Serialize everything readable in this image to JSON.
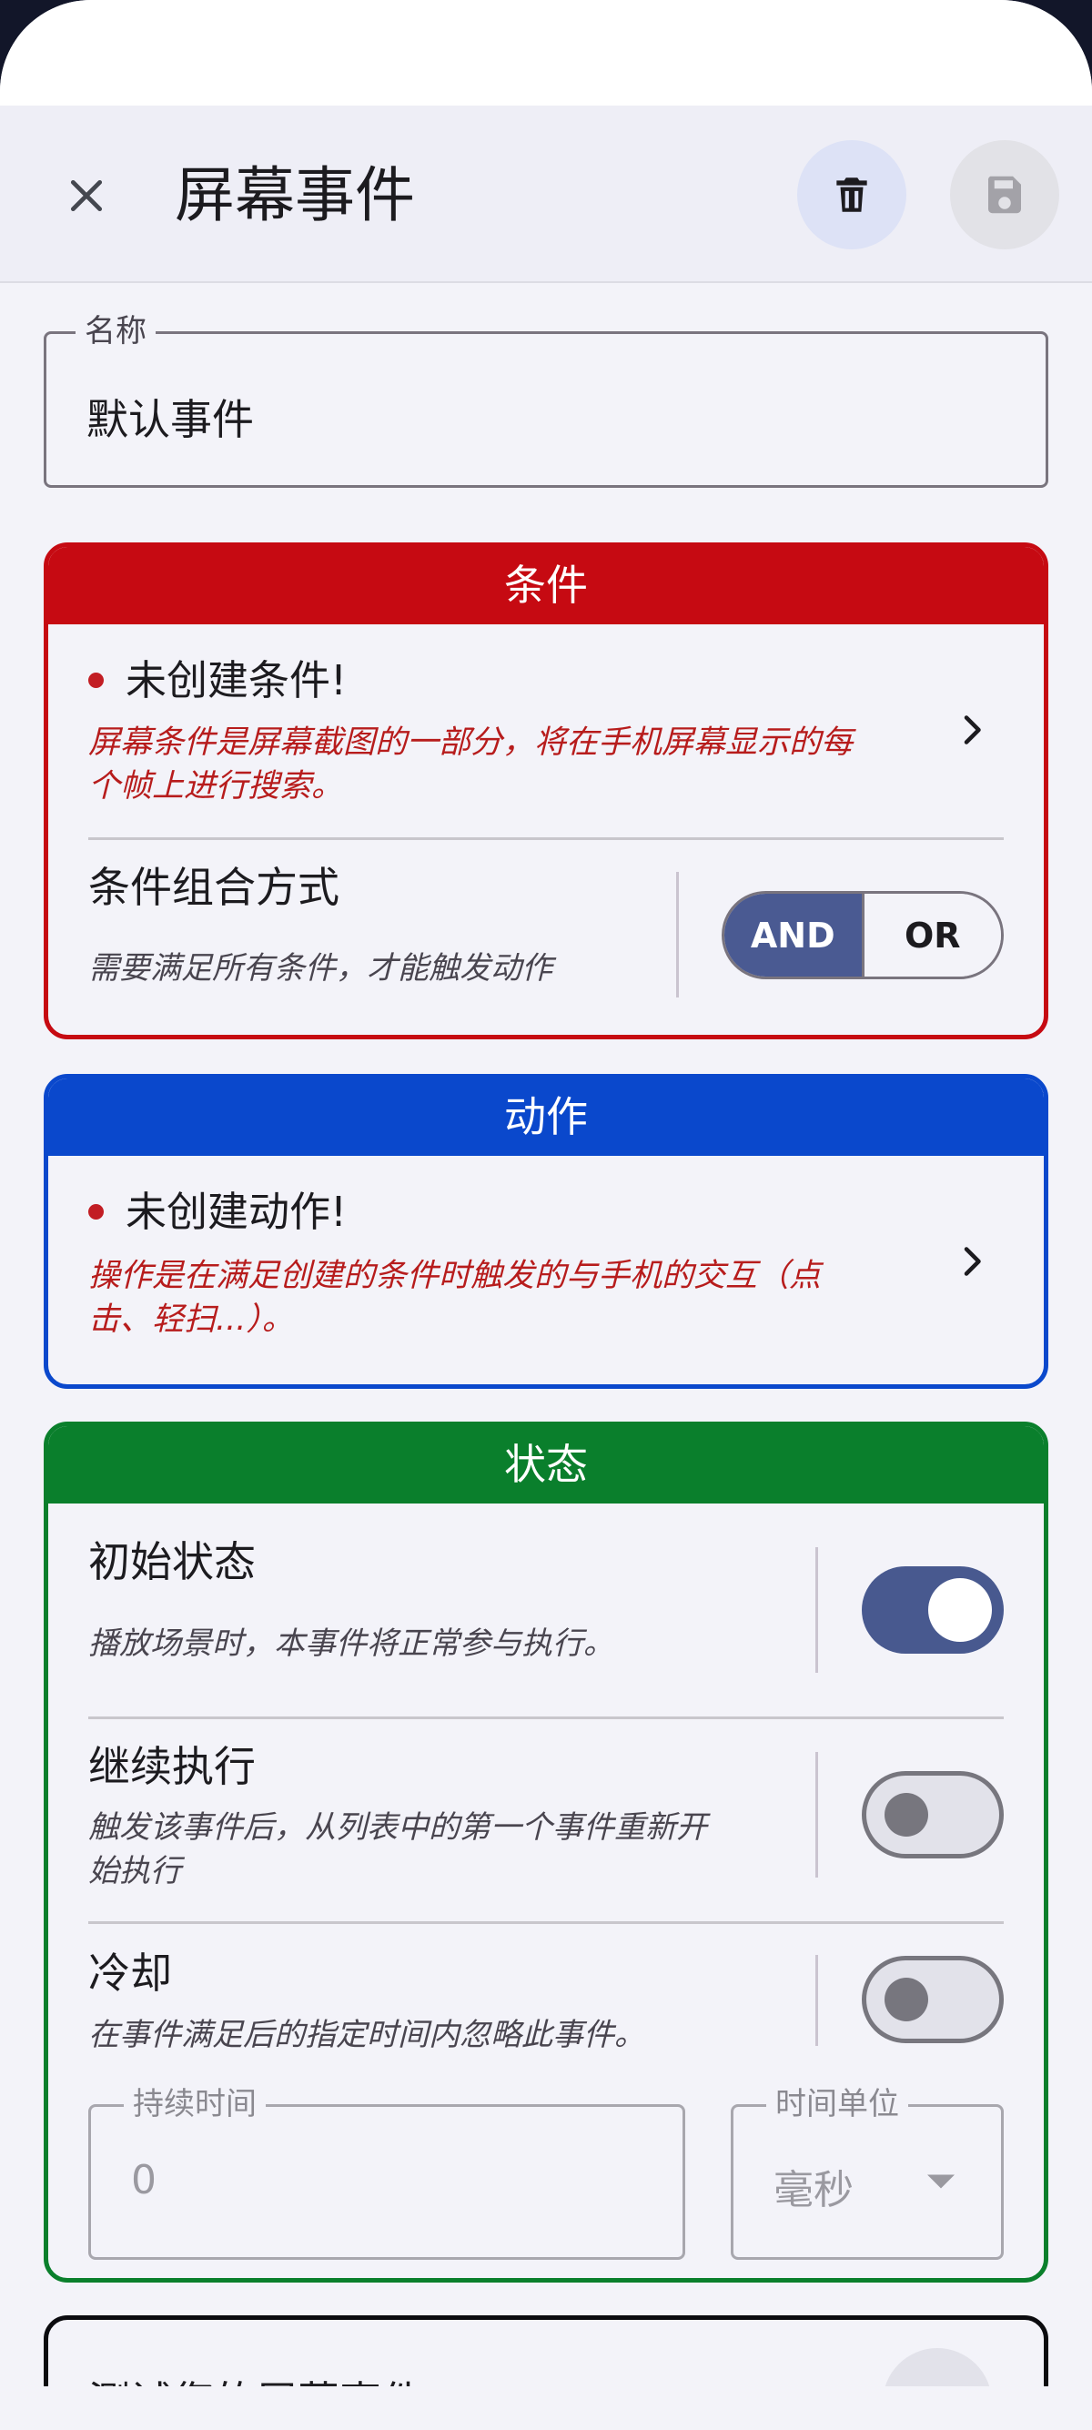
{
  "header": {
    "title": "屏幕事件",
    "close_icon": "close-icon",
    "delete_icon": "trash-icon",
    "save_icon": "save-icon"
  },
  "name_field": {
    "label": "名称",
    "value": "默认事件"
  },
  "conditions_card": {
    "header": "条件",
    "color": "#c60a12",
    "warning_title": "未创建条件!",
    "warning_desc_line1": "屏幕条件是屏幕截图的一部分，将在手机屏幕显示的每",
    "warning_desc_line2": "个帧上进行搜索。",
    "operator_title": "条件组合方式",
    "operator_desc": "需要满足所有条件，才能触发动作",
    "operator_options": [
      "AND",
      "OR"
    ],
    "operator_selected": "AND"
  },
  "actions_card": {
    "header": "动作",
    "color": "#0a48cc",
    "warning_title": "未创建动作!",
    "warning_desc_line1": "操作是在满足创建的条件时触发的与手机的交互（点",
    "warning_desc_line2": "击、轻扫...）。"
  },
  "state_card": {
    "header": "状态",
    "color": "#0a7f2c",
    "initial_state": {
      "title": "初始状态",
      "desc": "播放场景时，本事件将正常参与执行。",
      "enabled": true
    },
    "keep_executing": {
      "title": "继续执行",
      "desc_line1": "触发该事件后，从列表中的第一个事件重新开",
      "desc_line2": "始执行",
      "enabled": false
    },
    "cooldown": {
      "title": "冷却",
      "desc": "在事件满足后的指定时间内忽略此事件。",
      "enabled": false,
      "duration_label": "持续时间",
      "duration_value": "0",
      "unit_label": "时间单位",
      "unit_value": "毫秒"
    }
  },
  "next_card": {
    "title_partial": "测试您的屏幕事件"
  }
}
